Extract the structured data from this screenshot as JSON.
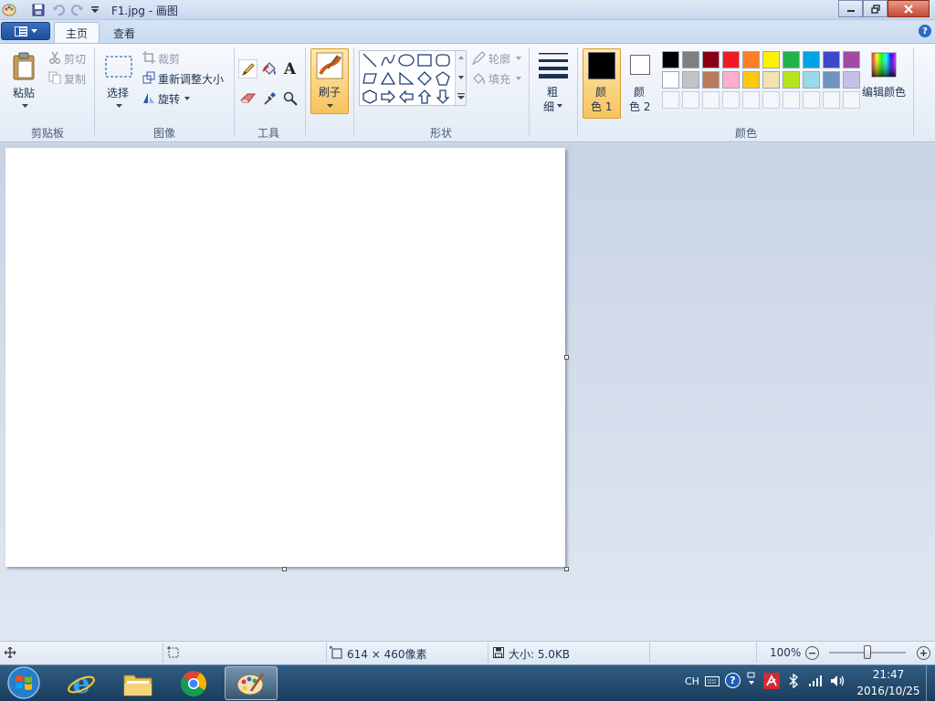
{
  "window": {
    "title": "F1.jpg - 画图"
  },
  "tabs": {
    "home": "主页",
    "view": "查看"
  },
  "clipboard": {
    "paste": "粘贴",
    "cut": "剪切",
    "copy": "复制",
    "group": "剪贴板"
  },
  "image": {
    "select": "选择",
    "crop": "裁剪",
    "resize": "重新调整大小",
    "rotate": "旋转",
    "group": "图像"
  },
  "tools": {
    "group": "工具"
  },
  "brush": {
    "label": "刷子"
  },
  "shapes": {
    "outline": "轮廓",
    "fill": "填充",
    "group": "形状"
  },
  "size": {
    "label_top": "粗",
    "label_bottom": "细"
  },
  "colors": {
    "color1_top": "颜",
    "color1_bottom": "色 1",
    "color2_top": "颜",
    "color2_bottom": "色 2",
    "edit": "编辑颜色",
    "group": "颜色",
    "color1_value": "#000000",
    "color2_value": "#ffffff",
    "palette_row1": [
      "#000000",
      "#7f7f7f",
      "#880015",
      "#ed1c24",
      "#ff7f27",
      "#fff200",
      "#22b14c",
      "#00a2e8",
      "#3f48cc",
      "#a349a4"
    ],
    "palette_row2": [
      "#ffffff",
      "#c3c3c3",
      "#b97a57",
      "#ffaec9",
      "#ffc90e",
      "#efe4b0",
      "#b5e61d",
      "#99d9ea",
      "#7092be",
      "#c8bfe7"
    ]
  },
  "status": {
    "dimensions": "614 × 460像素",
    "filesize": "大小: 5.0KB",
    "zoom": "100%",
    "zoom_fraction": 0.5
  },
  "taskbar": {
    "lang": "CH",
    "time": "21:47",
    "date": "2016/10/25"
  }
}
